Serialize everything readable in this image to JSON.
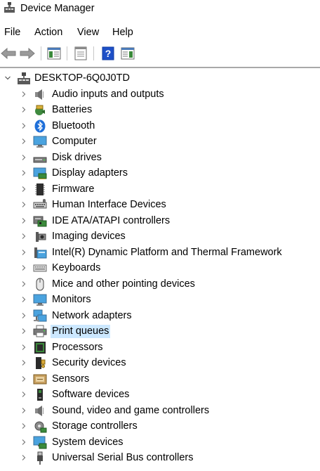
{
  "window": {
    "title": "Device Manager"
  },
  "menu": {
    "items": [
      {
        "label": "File"
      },
      {
        "label": "Action"
      },
      {
        "label": "View"
      },
      {
        "label": "Help"
      }
    ]
  },
  "toolbar": {
    "buttons": [
      {
        "icon": "back-arrow-icon"
      },
      {
        "icon": "forward-arrow-icon"
      },
      {
        "icon": "show-hide-console-tree-icon"
      },
      {
        "icon": "properties-icon"
      },
      {
        "icon": "help-icon"
      },
      {
        "icon": "show-action-pane-icon"
      }
    ]
  },
  "tree": {
    "root": {
      "label": "DESKTOP-6Q0J0TD",
      "icon": "computer-tower-icon",
      "expanded": true
    },
    "selected_item": "Print queues",
    "items": [
      {
        "label": "Audio inputs and outputs",
        "icon": "speaker-icon"
      },
      {
        "label": "Batteries",
        "icon": "battery-icon"
      },
      {
        "label": "Bluetooth",
        "icon": "bluetooth-icon"
      },
      {
        "label": "Computer",
        "icon": "monitor-icon"
      },
      {
        "label": "Disk drives",
        "icon": "disk-drive-icon"
      },
      {
        "label": "Display adapters",
        "icon": "display-adapter-icon"
      },
      {
        "label": "Firmware",
        "icon": "firmware-chip-icon"
      },
      {
        "label": "Human Interface Devices",
        "icon": "hid-icon"
      },
      {
        "label": "IDE ATA/ATAPI controllers",
        "icon": "ide-controller-icon"
      },
      {
        "label": "Imaging devices",
        "icon": "camera-icon"
      },
      {
        "label": "Intel(R) Dynamic Platform and Thermal Framework",
        "icon": "folder-icon"
      },
      {
        "label": "Keyboards",
        "icon": "keyboard-icon"
      },
      {
        "label": "Mice and other pointing devices",
        "icon": "mouse-icon"
      },
      {
        "label": "Monitors",
        "icon": "monitor-icon"
      },
      {
        "label": "Network adapters",
        "icon": "network-adapter-icon"
      },
      {
        "label": "Print queues",
        "icon": "printer-icon"
      },
      {
        "label": "Processors",
        "icon": "processor-icon"
      },
      {
        "label": "Security devices",
        "icon": "security-device-icon"
      },
      {
        "label": "Sensors",
        "icon": "sensor-icon"
      },
      {
        "label": "Software devices",
        "icon": "software-device-icon"
      },
      {
        "label": "Sound, video and game controllers",
        "icon": "speaker-icon"
      },
      {
        "label": "Storage controllers",
        "icon": "storage-controller-icon"
      },
      {
        "label": "System devices",
        "icon": "system-devices-icon"
      },
      {
        "label": "Universal Serial Bus controllers",
        "icon": "usb-icon"
      }
    ]
  },
  "colors": {
    "selection": "#cce8ff",
    "divider": "#a9a9a9",
    "help_blue": "#1e50c8"
  }
}
